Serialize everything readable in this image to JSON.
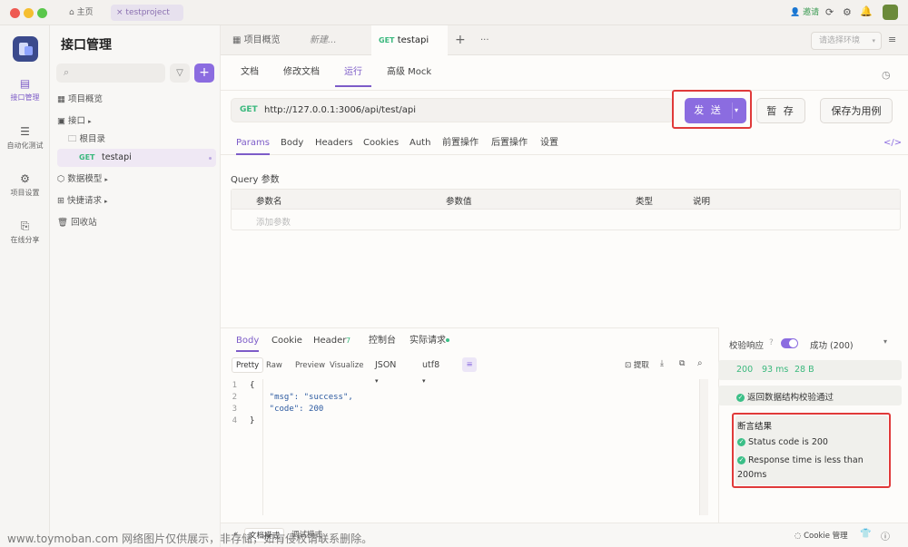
{
  "titlebar": {
    "home": "主页",
    "project_tab": "testproject",
    "invite": "邀请",
    "colors": {
      "red": "#ee5a52",
      "yellow": "#f5be30",
      "green": "#5ac74b"
    }
  },
  "rail": {
    "items": [
      "接口管理",
      "自动化测试",
      "项目设置",
      "在线分享"
    ],
    "icons": [
      "api-icon",
      "flow-icon",
      "settings-icon",
      "share-icon"
    ]
  },
  "sidebar": {
    "title": "接口管理",
    "search_placeholder": "",
    "items": {
      "overview": "项目概览",
      "api": "接口",
      "root": "根目录",
      "method": "GET",
      "name": "testapi",
      "models": "数据模型",
      "quick": "快捷请求",
      "trash": "回收站"
    }
  },
  "tabs": {
    "overview": "项目概览",
    "new": "新建...",
    "method": "GET",
    "current": "testapi",
    "env_placeholder": "请选择环境"
  },
  "subnav": {
    "doc": "文档",
    "edit": "修改文档",
    "run": "运行",
    "mock": "高级 Mock"
  },
  "request": {
    "method": "GET",
    "url": "http://127.0.0.1:3006/api/test/api",
    "send": "发 送",
    "save": "暂 存",
    "save_case": "保存为用例"
  },
  "params_tabs": [
    "Params",
    "Body",
    "Headers",
    "Cookies",
    "Auth",
    "前置操作",
    "后置操作",
    "设置"
  ],
  "query": {
    "label": "Query 参数",
    "headers": [
      "参数名",
      "参数值",
      "类型",
      "说明"
    ],
    "add": "添加参数"
  },
  "response": {
    "tabs": [
      "Body",
      "Cookie",
      "Header",
      "控制台",
      "实际请求"
    ],
    "header_count": "7",
    "formats": [
      "Pretty",
      "Raw",
      "Preview",
      "Visualize"
    ],
    "lang": "JSON",
    "encoding": "utf8",
    "extract": "提取",
    "code": [
      {
        "n": "1",
        "t": "{"
      },
      {
        "n": "2",
        "t": "    \"msg\": \"success\","
      },
      {
        "n": "3",
        "t": "    \"code\": 200"
      },
      {
        "n": "4",
        "t": "}"
      }
    ]
  },
  "validation": {
    "label": "校验响应",
    "status": "成功 (200)",
    "code": "200",
    "time": "93 ms",
    "size": "28 B",
    "schema_pass": "返回数据结构校验通过",
    "assert_title": "断言结果",
    "asserts": [
      "Status code is 200",
      "Response time is less than 200ms"
    ]
  },
  "footer": {
    "doc_mode": "文档模式",
    "debug_mode": "调试模式",
    "cookie": "Cookie 管理",
    "watermark": "www.toymoban.com 网络图片仅供展示，非存储，如有侵权请联系删除。"
  }
}
